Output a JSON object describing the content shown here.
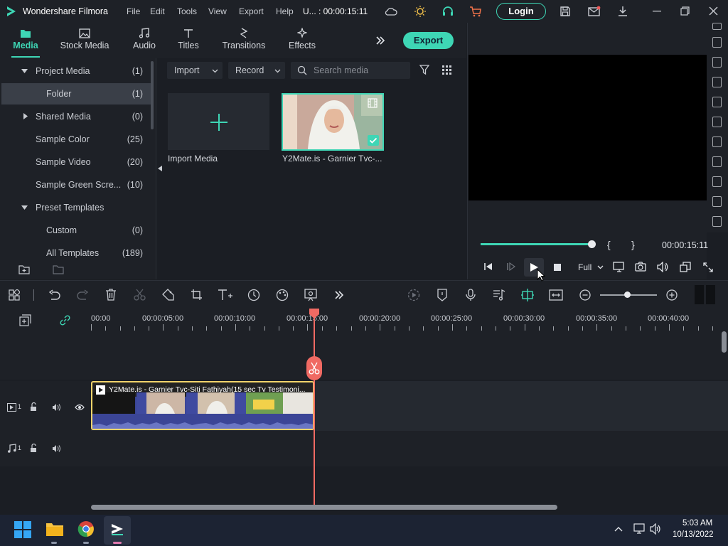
{
  "app": {
    "title": "Wondershare Filmora",
    "menu": [
      "File",
      "Edit",
      "Tools",
      "View",
      "Export",
      "Help"
    ],
    "project_time": "U... : 00:00:15:11",
    "login_label": "Login"
  },
  "tabs": [
    {
      "label": "Media",
      "icon": "folder-icon",
      "active": true
    },
    {
      "label": "Stock Media",
      "icon": "image-icon"
    },
    {
      "label": "Audio",
      "icon": "music-note-icon"
    },
    {
      "label": "Titles",
      "icon": "text-icon"
    },
    {
      "label": "Transitions",
      "icon": "transition-icon"
    },
    {
      "label": "Effects",
      "icon": "sparkle-icon"
    }
  ],
  "export_label": "Export",
  "sidebar": {
    "items": [
      {
        "label": "Project Media",
        "count": "(1)",
        "arrow": "down"
      },
      {
        "label": "Folder",
        "count": "(1)",
        "selected": true
      },
      {
        "label": "Shared Media",
        "count": "(0)",
        "arrow": "right"
      },
      {
        "label": "Sample Color",
        "count": "(25)"
      },
      {
        "label": "Sample Video",
        "count": "(20)"
      },
      {
        "label": "Sample Green Scre...",
        "count": "(10)"
      },
      {
        "label": "Preset Templates",
        "count": "",
        "arrow": "down"
      },
      {
        "label": "Custom",
        "count": "(0)"
      },
      {
        "label": "All Templates",
        "count": "(189)"
      }
    ]
  },
  "media": {
    "import_label": "Import",
    "record_label": "Record",
    "search_placeholder": "Search media",
    "import_media_label": "Import Media",
    "clip_label": "Y2Mate.is - Garnier Tvc-..."
  },
  "preview": {
    "timecode": "00:00:15:11",
    "quality": "Full",
    "progress": 1.0,
    "mark_in": "{",
    "mark_out": "}"
  },
  "timeline": {
    "ruler": [
      "00:00",
      "00:00:05:00",
      "00:00:10:00",
      "00:00:15:00",
      "00:00:20:00",
      "00:00:25:00",
      "00:00:30:00",
      "00:00:35:00",
      "00:00:40:00"
    ],
    "clip_title": "Y2Mate.is - Garnier Tvc-Siti Fathiyah(15 sec Tv Testimoni...",
    "video_track": "1",
    "audio_track": "1"
  },
  "taskbar": {
    "time": "5:03 AM",
    "date": "10/13/2022"
  },
  "colors": {
    "accent": "#3ed6b5",
    "playhead": "#f06a63",
    "clip_border": "#f2d46a"
  }
}
